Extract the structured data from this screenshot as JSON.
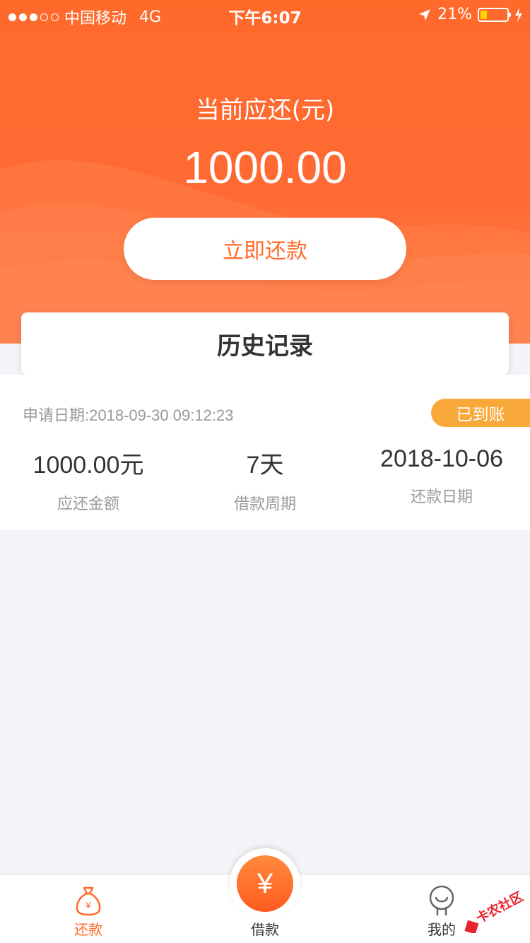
{
  "status_bar": {
    "carrier": "中国移动",
    "network": "4G",
    "time": "下午6:07",
    "battery": "21%"
  },
  "header": {
    "due_label": "当前应还(元)",
    "due_amount": "1000.00",
    "repay_button": "立即还款"
  },
  "history": {
    "title": "历史记录"
  },
  "record": {
    "apply_date": "申请日期:2018-09-30 09:12:23",
    "status": "已到账",
    "amount_value": "1000.00元",
    "amount_label": "应还金额",
    "period_value": "7天",
    "period_label": "借款周期",
    "repay_date_value": "2018-10-06",
    "repay_date_label": "还款日期"
  },
  "tabbar": {
    "tab_repay": "还款",
    "tab_borrow": "借款",
    "tab_mine": "我的",
    "center_symbol": "¥"
  },
  "watermark": "卡农社区",
  "colors": {
    "accent": "#ff6a2b",
    "badge": "#f8a93a",
    "background": "#f2f4f7"
  }
}
